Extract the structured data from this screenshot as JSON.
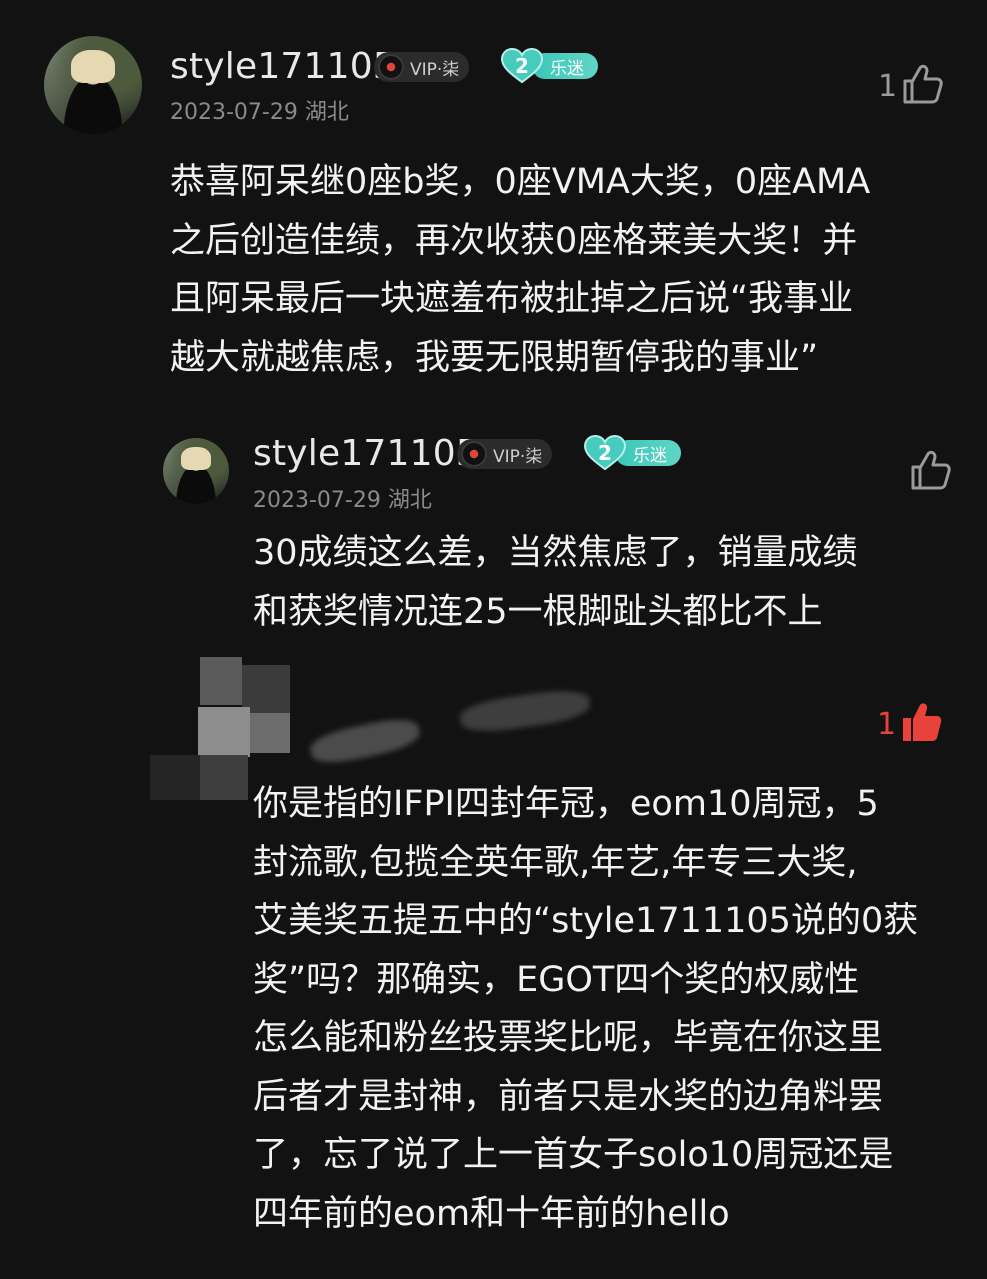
{
  "comment1": {
    "username": "style171105",
    "vip_label": "VIP·柒",
    "level_number": "2",
    "level_tag": "乐迷",
    "date_location": "2023-07-29 湖北",
    "like_count": "1",
    "text_lines": [
      "恭喜阿呆继0座b奖，0座VMA大奖，0座AMA",
      "之后创造佳绩，再次收获0座格莱美大奖！并",
      "且阿呆最后一块遮羞布被扯掉之后说“我事业",
      "越大就越焦虑，我要无限期暂停我的事业”"
    ]
  },
  "reply1": {
    "username": "style171105",
    "vip_label": "VIP·柒",
    "level_number": "2",
    "level_tag": "乐迷",
    "date_location": "2023-07-29 湖北",
    "like_count": "",
    "text_lines": [
      "30成绩这么差，当然焦虑了，销量成绩",
      "和获奖情况连25一根脚趾头都比不上"
    ]
  },
  "reply2": {
    "like_count": "1",
    "text_lines": [
      "你是指的IFPI四封年冠，eom10周冠，5",
      "封流歌,包揽全英年歌,年艺,年专三大奖,",
      "艾美奖五提五中的“style1711105说的0获",
      "奖”吗？那确实，EGOT四个奖的权威性",
      "怎么能和粉丝投票奖比呢，毕竟在你这里",
      "后者才是封神，前者只是水奖的边角料罢",
      "了，忘了说了上一首女子solo10周冠还是",
      "四年前的eom和十年前的hello"
    ]
  },
  "colors": {
    "background": "#121212",
    "text": "#f2f2f2",
    "muted": "#8a8a8a",
    "like_active": "#e8423a",
    "level_teal": "#46cbbd"
  }
}
